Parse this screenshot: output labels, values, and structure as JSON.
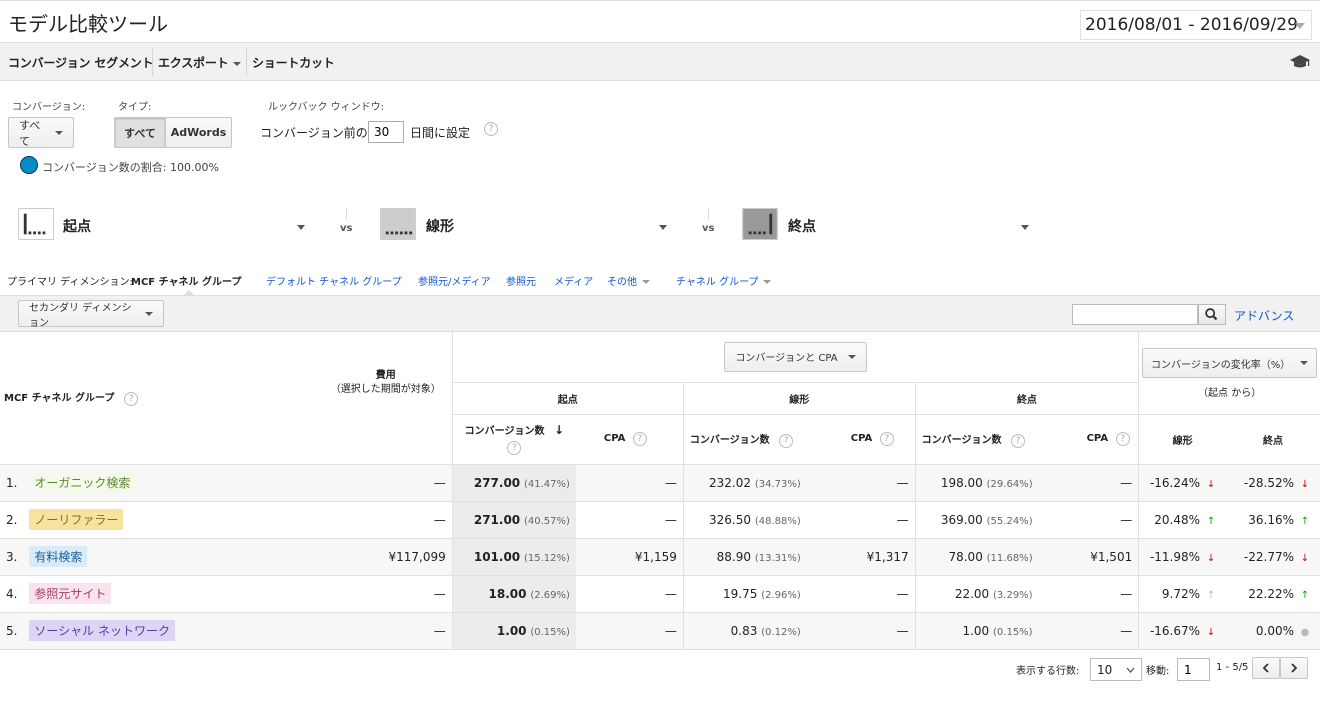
{
  "header": {
    "title": "モデル比較ツール",
    "date_range": "2016/08/01 - 2016/09/29"
  },
  "toolbar": {
    "items": [
      "コンバージョン セグメント",
      "エクスポート",
      "ショートカット"
    ]
  },
  "controls": {
    "conversion_label": "コンバージョン:",
    "conversion_value": "すべて",
    "type_label": "タイプ:",
    "type_options": [
      "すべて",
      "AdWords"
    ],
    "lookback_label": "ルックバック ウィンドウ:",
    "lookback_prefix": "コンバージョン前の",
    "lookback_value": "30",
    "lookback_suffix": "日間に設定",
    "share_text": "コンバージョン数の割合: 100.00%"
  },
  "models": [
    {
      "name": "起点",
      "icon": "first-interaction-icon"
    },
    {
      "name": "線形",
      "icon": "linear-icon"
    },
    {
      "name": "終点",
      "icon": "last-interaction-icon"
    }
  ],
  "vs_label": "vs",
  "dimensions": {
    "label": "プライマリ ディメンション:",
    "active": "MCF チャネル グループ",
    "links": [
      "デフォルト チャネル グループ",
      "参照元/メディア",
      "参照元",
      "メディア"
    ],
    "other": "その他",
    "channel_group": "チャネル グループ"
  },
  "secondary_dim": "セカンダリ ディメンション",
  "advanced_link": "アドバンス",
  "table": {
    "metric_select": "コンバージョンと CPA",
    "change_select": "コンバージョンの変化率（%）",
    "change_sub": "（起点 から）",
    "dim_header": "MCF チャネル グループ",
    "cost_header": "費用",
    "cost_sub": "（選択した期間が対象）",
    "groups": [
      "起点",
      "線形",
      "終点"
    ],
    "conv_header": "コンバージョン数",
    "cpa_header": "CPA",
    "change_cols": [
      "線形",
      "終点"
    ],
    "rows": [
      {
        "idx": "1.",
        "name": "オーガニック検索",
        "bg": "#f4f9ec",
        "fg": "#5b8a2a",
        "cost": "—",
        "c1": "277.00",
        "p1": "(41.47%)",
        "cpa1": "—",
        "c2": "232.02",
        "p2": "(34.73%)",
        "cpa2": "—",
        "c3": "198.00",
        "p3": "(29.64%)",
        "cpa3": "—",
        "d1": "-16.24%",
        "a1": "down",
        "d2": "-28.52%",
        "a2": "down"
      },
      {
        "idx": "2.",
        "name": "ノーリファラー",
        "bg": "#f6e3a0",
        "fg": "#8a6d1a",
        "cost": "—",
        "c1": "271.00",
        "p1": "(40.57%)",
        "cpa1": "—",
        "c2": "326.50",
        "p2": "(48.88%)",
        "cpa2": "—",
        "c3": "369.00",
        "p3": "(55.24%)",
        "cpa3": "—",
        "d1": "20.48%",
        "a1": "up",
        "d2": "36.16%",
        "a2": "up"
      },
      {
        "idx": "3.",
        "name": "有料検索",
        "bg": "#d8ebf8",
        "fg": "#1a5f9a",
        "cost": "¥117,099",
        "c1": "101.00",
        "p1": "(15.12%)",
        "cpa1": "¥1,159",
        "c2": "88.90",
        "p2": "(13.31%)",
        "cpa2": "¥1,317",
        "c3": "78.00",
        "p3": "(11.68%)",
        "cpa3": "¥1,501",
        "d1": "-11.98%",
        "a1": "down",
        "d2": "-22.77%",
        "a2": "down"
      },
      {
        "idx": "4.",
        "name": "参照元サイト",
        "bg": "#fae3ee",
        "fg": "#a0406a",
        "cost": "—",
        "c1": "18.00",
        "p1": "(2.69%)",
        "cpa1": "—",
        "c2": "19.75",
        "p2": "(2.96%)",
        "cpa2": "—",
        "c3": "22.00",
        "p3": "(3.29%)",
        "cpa3": "—",
        "d1": "9.72%",
        "a1": "neutral",
        "d2": "22.22%",
        "a2": "up"
      },
      {
        "idx": "5.",
        "name": "ソーシャル ネットワーク",
        "bg": "#ddd4f6",
        "fg": "#5a3a9a",
        "cost": "—",
        "c1": "1.00",
        "p1": "(0.15%)",
        "cpa1": "—",
        "c2": "0.83",
        "p2": "(0.12%)",
        "cpa2": "—",
        "c3": "1.00",
        "p3": "(0.15%)",
        "cpa3": "—",
        "d1": "-16.67%",
        "a1": "down",
        "d2": "0.00%",
        "a2": "dot"
      }
    ]
  },
  "pager": {
    "rows_label": "表示する行数:",
    "rows_value": "10",
    "goto_label": "移動:",
    "goto_value": "1",
    "range": "1 - 5/5"
  }
}
